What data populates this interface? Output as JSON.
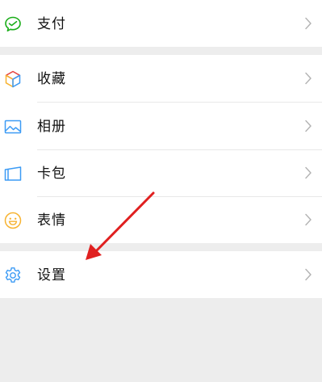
{
  "menu": {
    "pay": {
      "label": "支付",
      "icon": "wallet-check-icon",
      "color": "#1aad19"
    },
    "favorites": {
      "label": "收藏",
      "icon": "cube-icon",
      "colors": [
        "#f7b331",
        "#e64340",
        "#3c9bf5"
      ]
    },
    "album": {
      "label": "相册",
      "icon": "picture-icon",
      "color": "#3c9bf5"
    },
    "cards": {
      "label": "卡包",
      "icon": "card-icon",
      "color": "#3c9bf5"
    },
    "stickers": {
      "label": "表情",
      "icon": "smiley-icon",
      "color": "#f7b331"
    },
    "settings": {
      "label": "设置",
      "icon": "gear-icon",
      "color": "#3c9bf5"
    }
  },
  "annotation": {
    "icon": "red-arrow-icon",
    "color": "#e02020"
  },
  "colors": {
    "background": "#ededed",
    "panel": "#ffffff",
    "text": "#111111",
    "chevron": "#b2b2b2"
  }
}
